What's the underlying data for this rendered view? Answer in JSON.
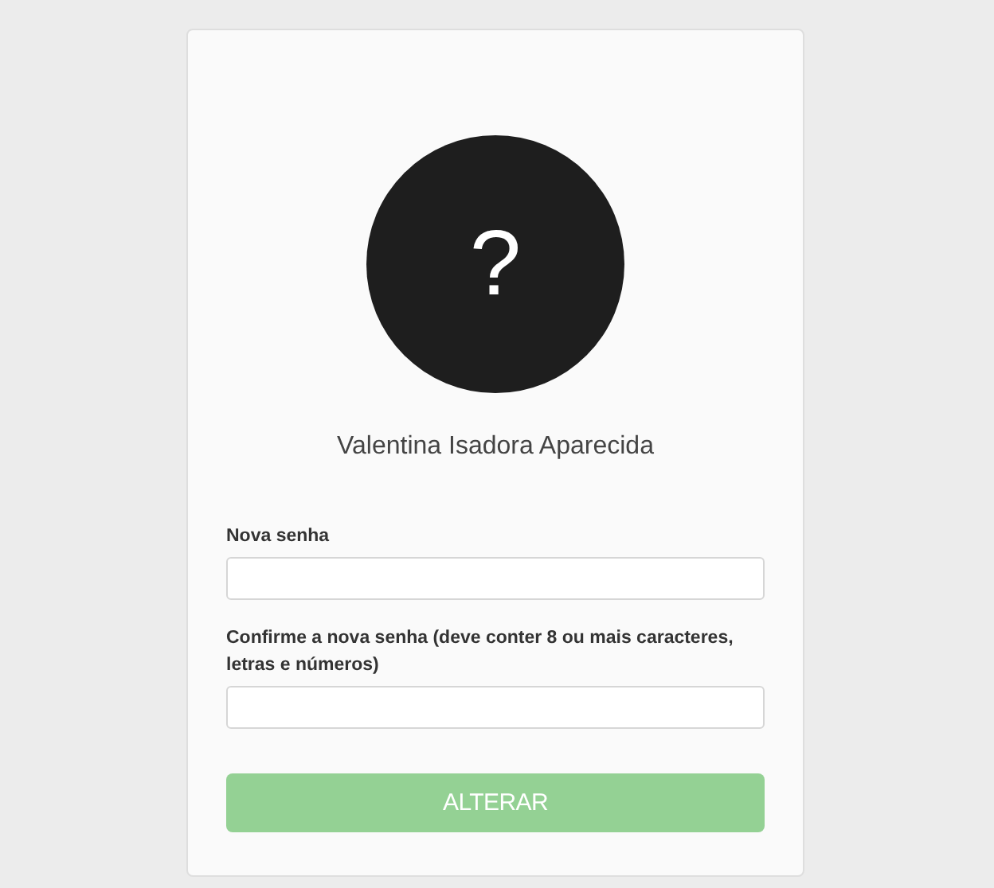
{
  "avatar": {
    "symbol": "?"
  },
  "user_name": "Valentina Isadora Aparecida",
  "fields": [
    {
      "label": "Nova senha"
    },
    {
      "label": "Confirme a nova senha (deve conter 8 ou mais caracteres, letras e números)"
    }
  ],
  "submit": {
    "label": "ALTERAR",
    "disabled": true
  }
}
